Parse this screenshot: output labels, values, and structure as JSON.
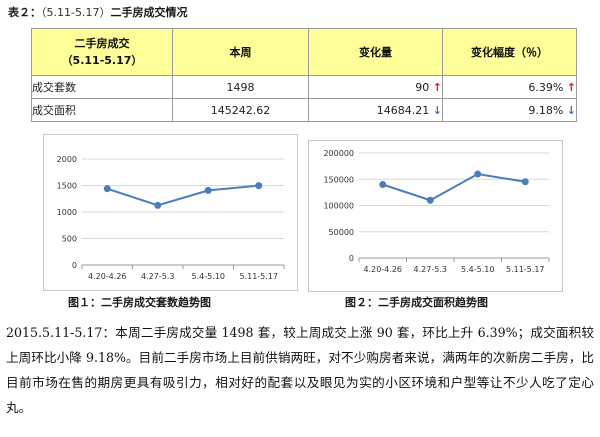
{
  "caption": {
    "prefix": "表２：",
    "range": "（5.11-5.17）",
    "title": "二手房成交情况"
  },
  "table": {
    "headers": {
      "col1_line1": "二手房成交",
      "col1_line2": "（5.11-5.17）",
      "col2": "本周",
      "col3": "变化量",
      "col4": "变化幅度（％）"
    },
    "rows": [
      {
        "label": "成交套数",
        "this_week": "1498",
        "change": "90",
        "change_dir": "up",
        "pct": "6.39%",
        "pct_dir": "up"
      },
      {
        "label": "成交面积",
        "this_week": "145242.62",
        "change": "14684.21",
        "change_dir": "down",
        "pct": "9.18%",
        "pct_dir": "down"
      }
    ],
    "arrows": {
      "up": "↑",
      "down": "↓"
    },
    "colors": {
      "header_bg": "#ffff99",
      "up": "#e02020",
      "down": "#3a6fc4"
    }
  },
  "chart_data": [
    {
      "type": "line",
      "categories": [
        "4.20-4.26",
        "4.27-5.3",
        "5.4-5.10",
        "5.11-5.17"
      ],
      "values": [
        1440,
        1125,
        1408,
        1498
      ],
      "ylim": [
        0,
        2000
      ],
      "yticks": [
        0,
        500,
        1000,
        1500,
        2000
      ],
      "grid": true,
      "line_color": "#4a7ebb",
      "caption": "图１：二手房成交套数趋势图"
    },
    {
      "type": "line",
      "categories": [
        "4.20-4.26",
        "4.27-5.3",
        "5.4-5.10",
        "5.11-5.17"
      ],
      "values": [
        140000,
        110000,
        159927,
        145242.62
      ],
      "ylim": [
        0,
        200000
      ],
      "yticks": [
        0,
        50000,
        100000,
        150000,
        200000
      ],
      "grid": true,
      "line_color": "#4a7ebb",
      "caption": "图２：二手房成交面积趋势图"
    }
  ],
  "paragraph": {
    "text": "2015.5.11-5.17：本周二手房成交量 1498 套，较上周成交上涨 90 套，环比上升 6.39%；成交面积较上周环比小降 9.18%。目前二手房市场上目前供销两旺，对不少购房者来说，满两年的次新房二手房，比目前市场在售的期房更具有吸引力，相对好的配套以及眼见为实的小区环境和户型等让不少人吃了定心丸。"
  }
}
